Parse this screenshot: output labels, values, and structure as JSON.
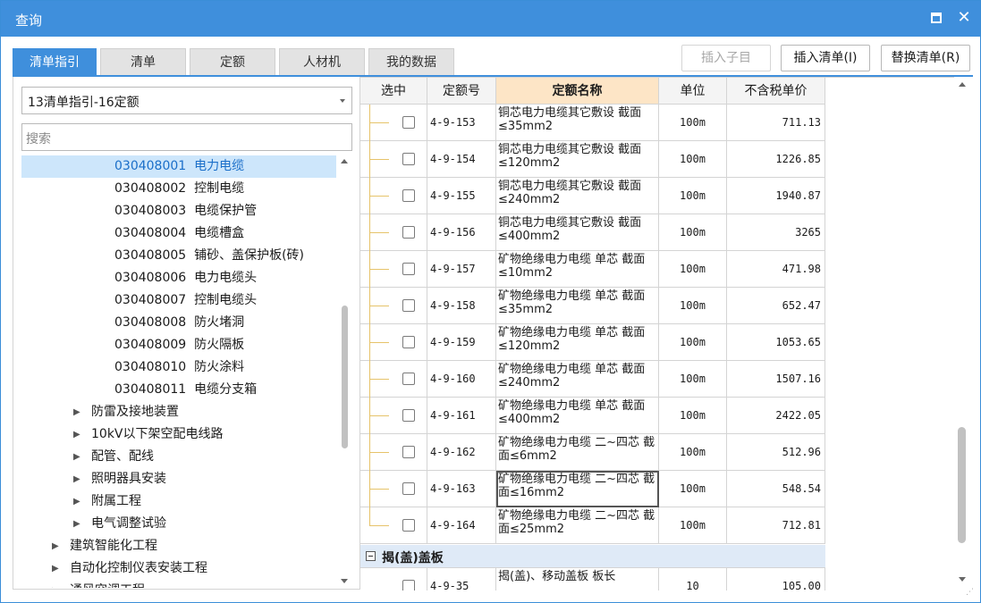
{
  "window": {
    "title": "查询"
  },
  "tabs": [
    {
      "label": "清单指引",
      "active": true
    },
    {
      "label": "清单",
      "active": false
    },
    {
      "label": "定额",
      "active": false
    },
    {
      "label": "人材机",
      "active": false
    },
    {
      "label": "我的数据",
      "active": false
    }
  ],
  "toolbar": {
    "insert_child_label": "插入子目",
    "insert_list_label": "插入清单(I)",
    "replace_list_label": "替换清单(R)"
  },
  "left": {
    "combo_value": "13清单指引-16定额",
    "search_placeholder": "搜索",
    "tree": [
      {
        "code": "030408001",
        "name": "电力电缆",
        "selected": true
      },
      {
        "code": "030408002",
        "name": "控制电缆"
      },
      {
        "code": "030408003",
        "name": "电缆保护管"
      },
      {
        "code": "030408004",
        "name": "电缆槽盒"
      },
      {
        "code": "030408005",
        "name": "铺砂、盖保护板(砖)"
      },
      {
        "code": "030408006",
        "name": "电力电缆头"
      },
      {
        "code": "030408007",
        "name": "控制电缆头"
      },
      {
        "code": "030408008",
        "name": "防火堵洞"
      },
      {
        "code": "030408009",
        "name": "防火隔板"
      },
      {
        "code": "030408010",
        "name": "防火涂料"
      },
      {
        "code": "030408011",
        "name": "电缆分支箱"
      }
    ],
    "groups_level2": [
      "防雷及接地装置",
      "10kV以下架空配电线路",
      "配管、配线",
      "照明器具安装",
      "附属工程",
      "电气调整试验"
    ],
    "groups_level1": [
      "建筑智能化工程",
      "自动化控制仪表安装工程",
      "通风空调工程"
    ]
  },
  "grid": {
    "headers": [
      "选中",
      "定额号",
      "定额名称",
      "单位",
      "不含税单价"
    ],
    "rows": [
      {
        "code": "4-9-153",
        "name": "铜芯电力电缆其它敷设 截面≤35mm2",
        "unit": "100m",
        "price": "711.13"
      },
      {
        "code": "4-9-154",
        "name": "铜芯电力电缆其它敷设 截面≤120mm2",
        "unit": "100m",
        "price": "1226.85"
      },
      {
        "code": "4-9-155",
        "name": "铜芯电力电缆其它敷设 截面≤240mm2",
        "unit": "100m",
        "price": "1940.87"
      },
      {
        "code": "4-9-156",
        "name": "铜芯电力电缆其它敷设 截面≤400mm2",
        "unit": "100m",
        "price": "3265"
      },
      {
        "code": "4-9-157",
        "name": "矿物绝缘电力电缆 单芯 截面≤10mm2",
        "unit": "100m",
        "price": "471.98"
      },
      {
        "code": "4-9-158",
        "name": "矿物绝缘电力电缆 单芯 截面≤35mm2",
        "unit": "100m",
        "price": "652.47"
      },
      {
        "code": "4-9-159",
        "name": "矿物绝缘电力电缆 单芯 截面≤120mm2",
        "unit": "100m",
        "price": "1053.65"
      },
      {
        "code": "4-9-160",
        "name": "矿物绝缘电力电缆 单芯 截面≤240mm2",
        "unit": "100m",
        "price": "1507.16"
      },
      {
        "code": "4-9-161",
        "name": "矿物绝缘电力电缆 单芯 截面≤400mm2",
        "unit": "100m",
        "price": "2422.05"
      },
      {
        "code": "4-9-162",
        "name": "矿物绝缘电力电缆 二~四芯 截面≤6mm2",
        "unit": "100m",
        "price": "512.96"
      },
      {
        "code": "4-9-163",
        "name": "矿物绝缘电力电缆 二~四芯 截面≤16mm2",
        "unit": "100m",
        "price": "548.54",
        "focused": true
      },
      {
        "code": "4-9-164",
        "name": "矿物绝缘电力电缆 二~四芯 截面≤25mm2",
        "unit": "100m",
        "price": "712.81"
      }
    ],
    "group_title": "揭(盖)盖板",
    "partial_row": {
      "code": "4-9-35",
      "name": "揭(盖)、移动盖板 板长",
      "unit": "10",
      "price": "105.00"
    }
  }
}
